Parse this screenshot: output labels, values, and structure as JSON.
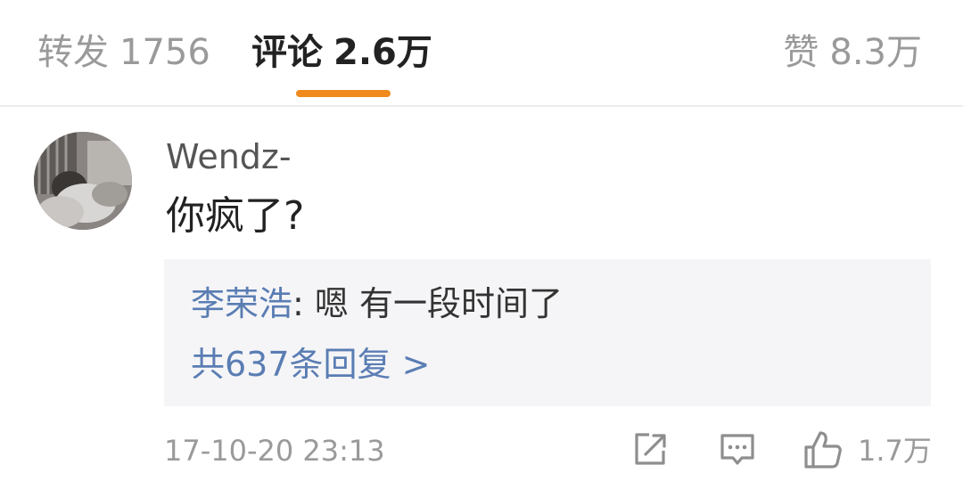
{
  "tabs": {
    "repost": {
      "label": "转发",
      "count": "1756"
    },
    "comments": {
      "label": "评论",
      "count": "2.6万"
    },
    "likes": {
      "label": "赞",
      "count": "8.3万"
    },
    "active": "comments",
    "accent_color": "#f08a1c"
  },
  "comment": {
    "author": "Wendz-",
    "text": "你疯了?",
    "timestamp": "17-10-20 23:13",
    "reply_preview": {
      "user": "李荣浩",
      "separator": ": ",
      "text": "嗯 有一段时间了"
    },
    "reply_total": "共637条回复 >",
    "actions": {
      "share_icon": "share-edit-icon",
      "reply_icon": "comment-bubble-icon",
      "like_icon": "thumbs-up-icon",
      "like_count": "1.7万"
    }
  },
  "colors": {
    "link_blue": "#5a7db3",
    "muted_gray": "#9a9a9a",
    "reply_bg": "#f5f5f7"
  }
}
